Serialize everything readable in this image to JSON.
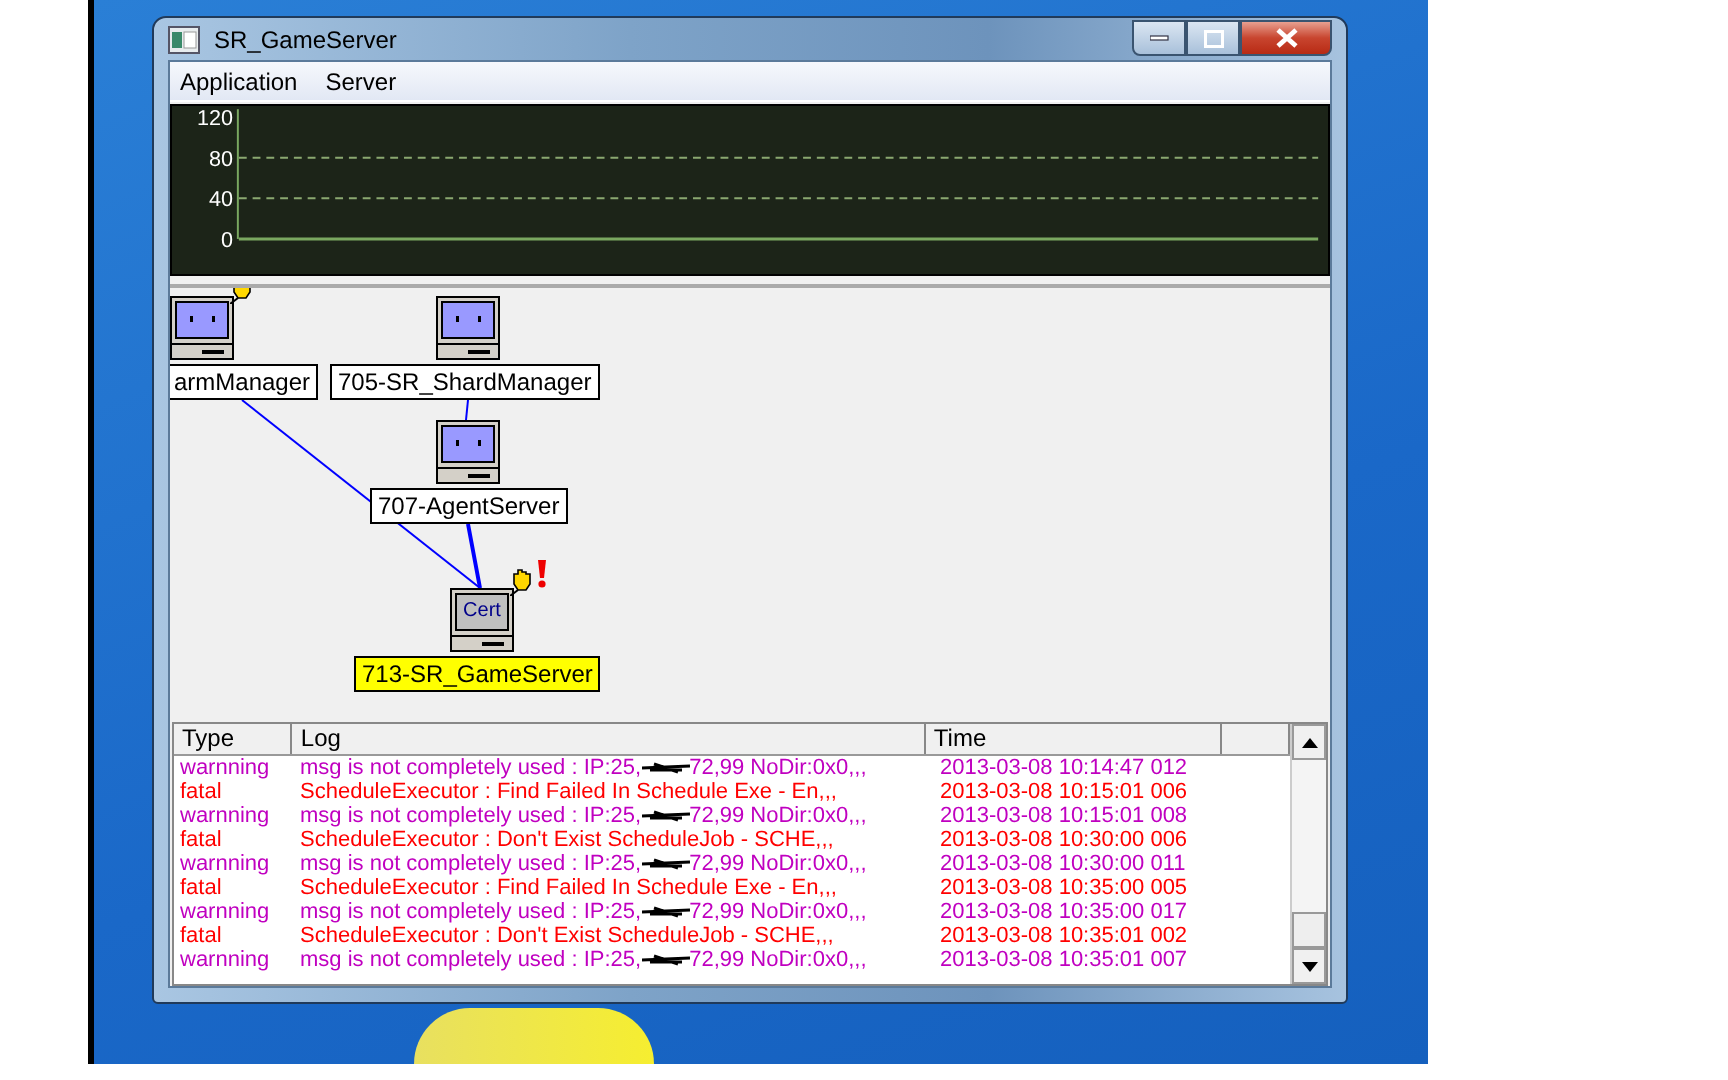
{
  "window": {
    "title": "SR_GameServer"
  },
  "menu": [
    {
      "label": "Application"
    },
    {
      "label": "Server"
    }
  ],
  "chart": {
    "y_labels": [
      "120",
      "80",
      "40",
      "0"
    ]
  },
  "diagram": {
    "nodes": [
      {
        "label": "armManager",
        "selected": false,
        "alert": false,
        "hand": true
      },
      {
        "label": "705-SR_ShardManager",
        "selected": false,
        "alert": false,
        "hand": false
      },
      {
        "label": "707-AgentServer",
        "selected": false,
        "alert": false,
        "hand": false
      },
      {
        "label": "713-SR_GameServer",
        "selected": true,
        "alert": true,
        "screen_text": "Cert",
        "hand": true
      }
    ]
  },
  "table": {
    "columns": [
      "Type",
      "Log",
      "Time"
    ],
    "rows": [
      {
        "color": "#c000c0",
        "type": "warnning",
        "log": "msg is not completely used : IP:25,",
        "log_after": "72,99 NoDir:0x0,,,",
        "time": "2013-03-08 10:14:47 012"
      },
      {
        "color": "#ff0000",
        "type": "fatal",
        "log": "ScheduleExecutor : Find Failed In Schedule Exe - En,,,",
        "time": "2013-03-08 10:15:01 006"
      },
      {
        "color": "#c000c0",
        "type": "warnning",
        "log": "msg is not completely used : IP:25,",
        "log_after": "72,99 NoDir:0x0,,,",
        "time": "2013-03-08 10:15:01 008"
      },
      {
        "color": "#ff0000",
        "type": "fatal",
        "log": "ScheduleExecutor : Don't Exist ScheduleJob - SCHE,,,",
        "time": "2013-03-08 10:30:00 006"
      },
      {
        "color": "#c000c0",
        "type": "warnning",
        "log": "msg is not completely used : IP:25,",
        "log_after": "72,99 NoDir:0x0,,,",
        "time": "2013-03-08 10:30:00 011"
      },
      {
        "color": "#ff0000",
        "type": "fatal",
        "log": "ScheduleExecutor : Find Failed In Schedule Exe - En,,,",
        "time": "2013-03-08 10:35:00 005"
      },
      {
        "color": "#c000c0",
        "type": "warnning",
        "log": "msg is not completely used : IP:25,",
        "log_after": "72,99 NoDir:0x0,,,",
        "time": "2013-03-08 10:35:00 017"
      },
      {
        "color": "#ff0000",
        "type": "fatal",
        "log": "ScheduleExecutor : Don't Exist ScheduleJob - SCHE,,,",
        "time": "2013-03-08 10:35:01 002"
      },
      {
        "color": "#c000c0",
        "type": "warnning",
        "log": "msg is not completely used : IP:25,",
        "log_after": "72,99 NoDir:0x0,,,",
        "time": "2013-03-08 10:35:01 007"
      }
    ]
  }
}
